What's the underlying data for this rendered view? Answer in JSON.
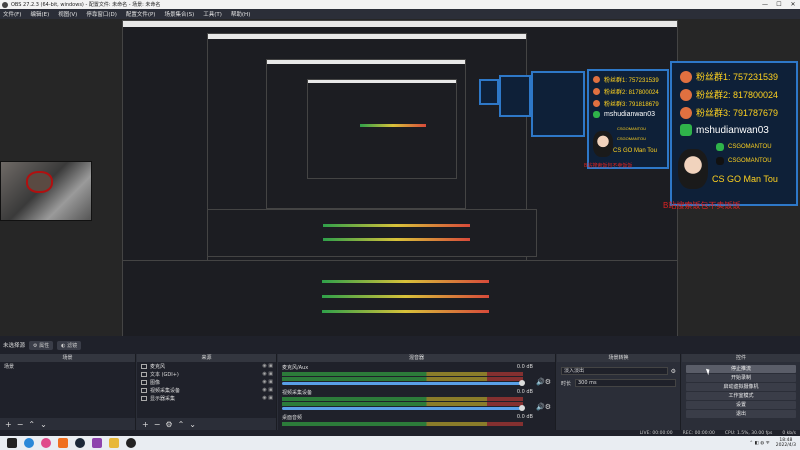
{
  "window": {
    "title": "OBS 27.2.3 (64-bit, windows) - 配置文件: 未命名 - 场景: 未命名",
    "minimize": "—",
    "maximize": "☐",
    "close": "✕"
  },
  "menu": [
    "文件(F)",
    "编辑(E)",
    "视图(V)",
    "停靠窗口(D)",
    "配置文件(P)",
    "场景集合(S)",
    "工具(T)",
    "帮助(H)"
  ],
  "overlay": {
    "large": {
      "fans1": "粉丝群1: 757231539",
      "fans2": "粉丝群2: 817800024",
      "fans3": "粉丝群3: 791787679",
      "wechat": "mshudianwan03",
      "wechat2": "CSGOMANTOU",
      "tiktok": "CSGOMANTOU",
      "name": "CS GO Man Tou",
      "red": "B站搜索饭包不卖饭饭"
    },
    "medium": {
      "fans1": "粉丝群1: 757231539",
      "fans2": "粉丝群2: 817800024",
      "fans3": "粉丝群3: 791818679",
      "wechat": "mshudianwan03",
      "wechat2": "CSGOMANTOU",
      "tiktok": "CSGOMANTOU",
      "name": "CS GO Man Tou",
      "red": "B站搜索饭包不卖饭饭"
    }
  },
  "scenebar": {
    "current": "未选择源",
    "properties": "属性",
    "filters": "滤镜"
  },
  "docks": {
    "scenes": {
      "header": "场景",
      "items": [
        "场景"
      ]
    },
    "sources": {
      "header": "来源",
      "items": [
        {
          "label": "麦克风",
          "icon": "mic-icon"
        },
        {
          "label": "文本 (GDI+)",
          "icon": "text-icon"
        },
        {
          "label": "图像",
          "icon": "image-icon"
        },
        {
          "label": "视频采集设备",
          "icon": "camera-icon"
        },
        {
          "label": "显示器采集",
          "icon": "monitor-icon"
        }
      ]
    },
    "mixer": {
      "header": "混音器",
      "channels": [
        {
          "name": "麦克风/Aux",
          "db": "0.0 dB"
        },
        {
          "name": "视频采集设备",
          "db": "0.0 dB"
        },
        {
          "name": "桌面音频",
          "db": "0.0 dB"
        }
      ]
    },
    "transitions": {
      "header": "场景转换",
      "type": "淡入淡出",
      "duration_label": "时长",
      "duration": "300 ms"
    },
    "controls": {
      "header": "控件",
      "buttons": [
        "停止推流",
        "开始录制",
        "启动虚拟摄像机",
        "工作室模式",
        "设置",
        "退出"
      ]
    }
  },
  "status": {
    "live": "LIVE: 00:00:00",
    "rec": "REC: 00:00:00",
    "cpu": "CPU: 1.5%, 30.00 fps",
    "kbps": "0 kb/s"
  },
  "taskbar": {
    "time": "18:48",
    "date": "2022/4/3"
  }
}
